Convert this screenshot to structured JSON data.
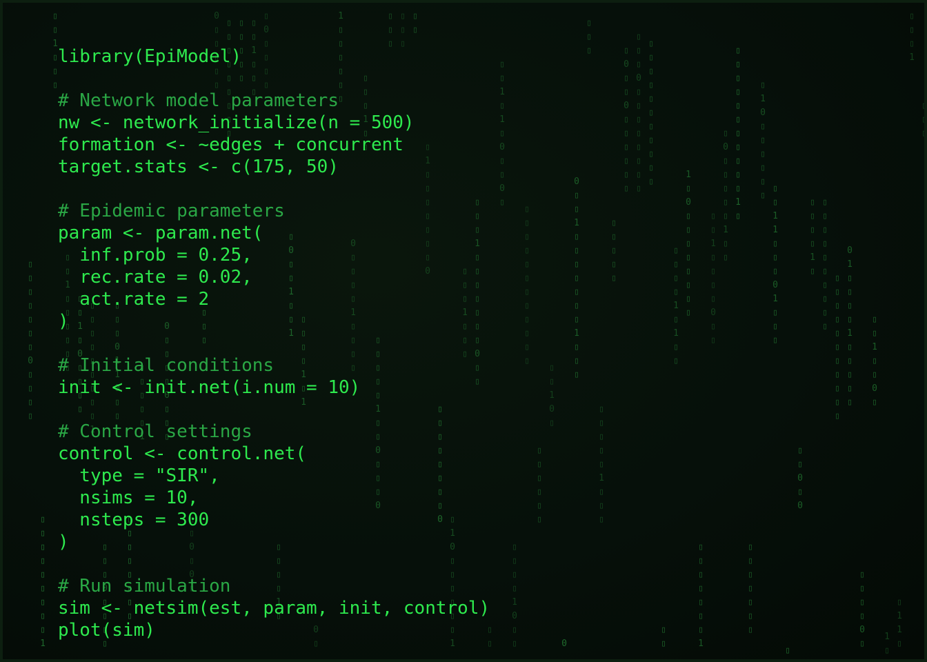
{
  "editor": {
    "language": "R",
    "theme": "matrix",
    "colors": {
      "background": "#050c06",
      "code": "#2eea4e",
      "comment": "#2aa745",
      "rain": "#1f6a2c"
    },
    "lines": [
      {
        "text": "library(EpiModel)",
        "kind": "code"
      },
      {
        "text": "",
        "kind": "blank"
      },
      {
        "text": "# Network model parameters",
        "kind": "comment"
      },
      {
        "text": "nw <- network_initialize(n = 500)",
        "kind": "code"
      },
      {
        "text": "formation <- ~edges + concurrent",
        "kind": "code"
      },
      {
        "text": "target.stats <- c(175, 50)",
        "kind": "code"
      },
      {
        "text": "",
        "kind": "blank"
      },
      {
        "text": "# Epidemic parameters",
        "kind": "comment"
      },
      {
        "text": "param <- param.net(",
        "kind": "code"
      },
      {
        "text": "  inf.prob = 0.25,",
        "kind": "code"
      },
      {
        "text": "  rec.rate = 0.02,",
        "kind": "code"
      },
      {
        "text": "  act.rate = 2",
        "kind": "code"
      },
      {
        "text": ")",
        "kind": "code"
      },
      {
        "text": "",
        "kind": "blank"
      },
      {
        "text": "# Initial conditions",
        "kind": "comment"
      },
      {
        "text": "init <- init.net(i.num = 10)",
        "kind": "code"
      },
      {
        "text": "",
        "kind": "blank"
      },
      {
        "text": "# Control settings",
        "kind": "comment"
      },
      {
        "text": "control <- control.net(",
        "kind": "code"
      },
      {
        "text": "  type = \"SIR\",",
        "kind": "code"
      },
      {
        "text": "  nsims = 10,",
        "kind": "code"
      },
      {
        "text": "  nsteps = 300",
        "kind": "code"
      },
      {
        "text": ")",
        "kind": "code"
      },
      {
        "text": "",
        "kind": "blank"
      },
      {
        "text": "# Run simulation",
        "kind": "comment"
      },
      {
        "text": "sim <- netsim(est, param, init, control)",
        "kind": "code"
      },
      {
        "text": "plot(sim)",
        "kind": "code"
      }
    ]
  }
}
